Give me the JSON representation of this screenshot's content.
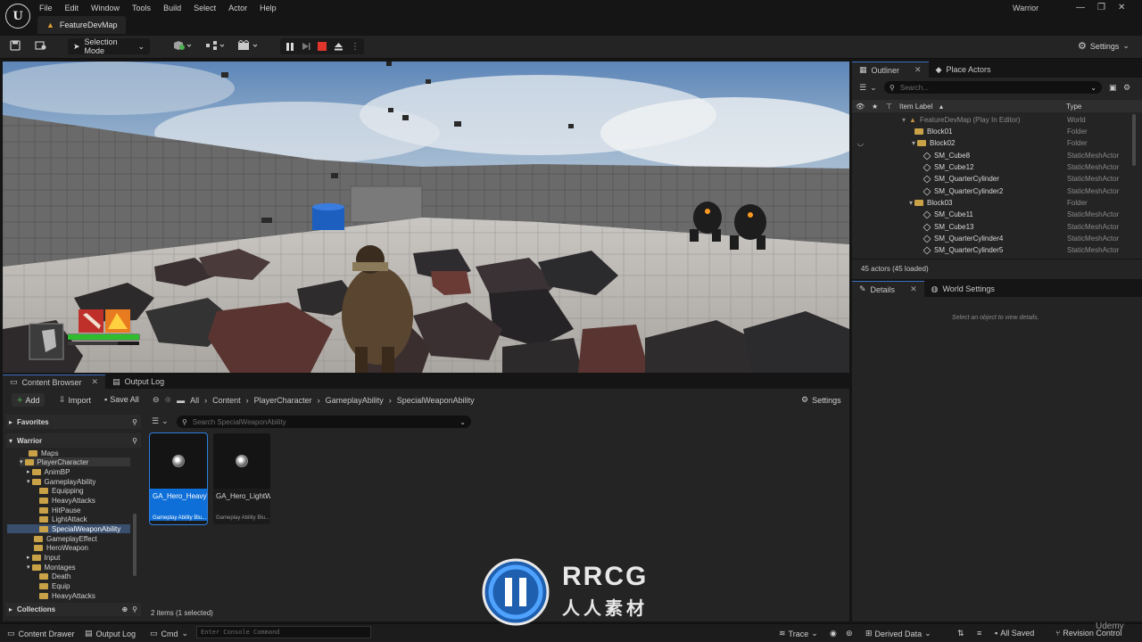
{
  "menubar": {
    "logo": "U",
    "items": [
      "File",
      "Edit",
      "Window",
      "Tools",
      "Build",
      "Select",
      "Actor",
      "Help"
    ],
    "map_tab": "FeatureDevMap",
    "project": "Warrior"
  },
  "toolbar": {
    "selection_mode": "Selection Mode",
    "settings_label": "Settings"
  },
  "outliner": {
    "tab_label": "Outliner",
    "place_actors_label": "Place Actors",
    "search_placeholder": "Search...",
    "col_label": "Item Label",
    "col_type": "Type",
    "rows": [
      {
        "label": "FeatureDevMap (Play In Editor)",
        "type": "World",
        "kind": "world"
      },
      {
        "label": "Block01",
        "type": "Folder",
        "kind": "folder"
      },
      {
        "label": "Block02",
        "type": "Folder",
        "kind": "folder"
      },
      {
        "label": "SM_Cube8",
        "type": "StaticMeshActor",
        "kind": "mesh"
      },
      {
        "label": "SM_Cube12",
        "type": "StaticMeshActor",
        "kind": "mesh"
      },
      {
        "label": "SM_QuarterCylinder",
        "type": "StaticMeshActor",
        "kind": "mesh"
      },
      {
        "label": "SM_QuarterCylinder2",
        "type": "StaticMeshActor",
        "kind": "mesh"
      },
      {
        "label": "Block03",
        "type": "Folder",
        "kind": "folder"
      },
      {
        "label": "SM_Cube11",
        "type": "StaticMeshActor",
        "kind": "mesh"
      },
      {
        "label": "SM_Cube13",
        "type": "StaticMeshActor",
        "kind": "mesh"
      },
      {
        "label": "SM_QuarterCylinder4",
        "type": "StaticMeshActor",
        "kind": "mesh"
      },
      {
        "label": "SM_QuarterCylinder5",
        "type": "StaticMeshActor",
        "kind": "mesh"
      }
    ],
    "status": "45 actors (45 loaded)"
  },
  "details": {
    "tab_label": "Details",
    "world_settings_label": "World Settings",
    "empty_text": "Select an object to view details."
  },
  "content_browser": {
    "tab_label": "Content Browser",
    "output_log_label": "Output Log",
    "add_label": "Add",
    "import_label": "Import",
    "save_all_label": "Save All",
    "settings_label": "Settings",
    "breadcrumb": [
      "All",
      "Content",
      "PlayerCharacter",
      "GameplayAbility",
      "SpecialWeaponAbility"
    ],
    "favorites_label": "Favorites",
    "root_label": "Warrior",
    "search_placeholder": "Search SpecialWeaponAbility",
    "tree": [
      {
        "label": "Maps",
        "depth": 1
      },
      {
        "label": "PlayerCharacter",
        "depth": 1
      },
      {
        "label": "AnimBP",
        "depth": 2
      },
      {
        "label": "GameplayAbility",
        "depth": 2
      },
      {
        "label": "Equipping",
        "depth": 3
      },
      {
        "label": "HeavyAttacks",
        "depth": 3
      },
      {
        "label": "HitPause",
        "depth": 3
      },
      {
        "label": "LightAttack",
        "depth": 3
      },
      {
        "label": "SpecialWeaponAbility",
        "depth": 3
      },
      {
        "label": "GameplayEffect",
        "depth": 2
      },
      {
        "label": "HeroWeapon",
        "depth": 2
      },
      {
        "label": "Input",
        "depth": 2
      },
      {
        "label": "Montages",
        "depth": 2
      },
      {
        "label": "Death",
        "depth": 3
      },
      {
        "label": "Equip",
        "depth": 3
      },
      {
        "label": "HeavyAttacks",
        "depth": 3
      }
    ],
    "collections_label": "Collections",
    "assets": [
      {
        "name": "GA_Hero_HeavyWeaponAbilit...",
        "class": "Gameplay Ability Blu..."
      },
      {
        "name": "GA_Hero_LightWeaponAbilit...",
        "class": "Gameplay Ability Blu..."
      }
    ],
    "item_count": "2 items (1 selected)"
  },
  "statusbar": {
    "content_drawer": "Content Drawer",
    "output_log": "Output Log",
    "cmd": "Cmd",
    "console_placeholder": "Enter Console Command",
    "trace": "Trace",
    "derived_data": "Derived Data",
    "all_saved": "All Saved",
    "revision_control": "Revision Control"
  },
  "watermark": {
    "brand": "RRCG",
    "subtitle": "人人素材",
    "site": "Udemy"
  }
}
